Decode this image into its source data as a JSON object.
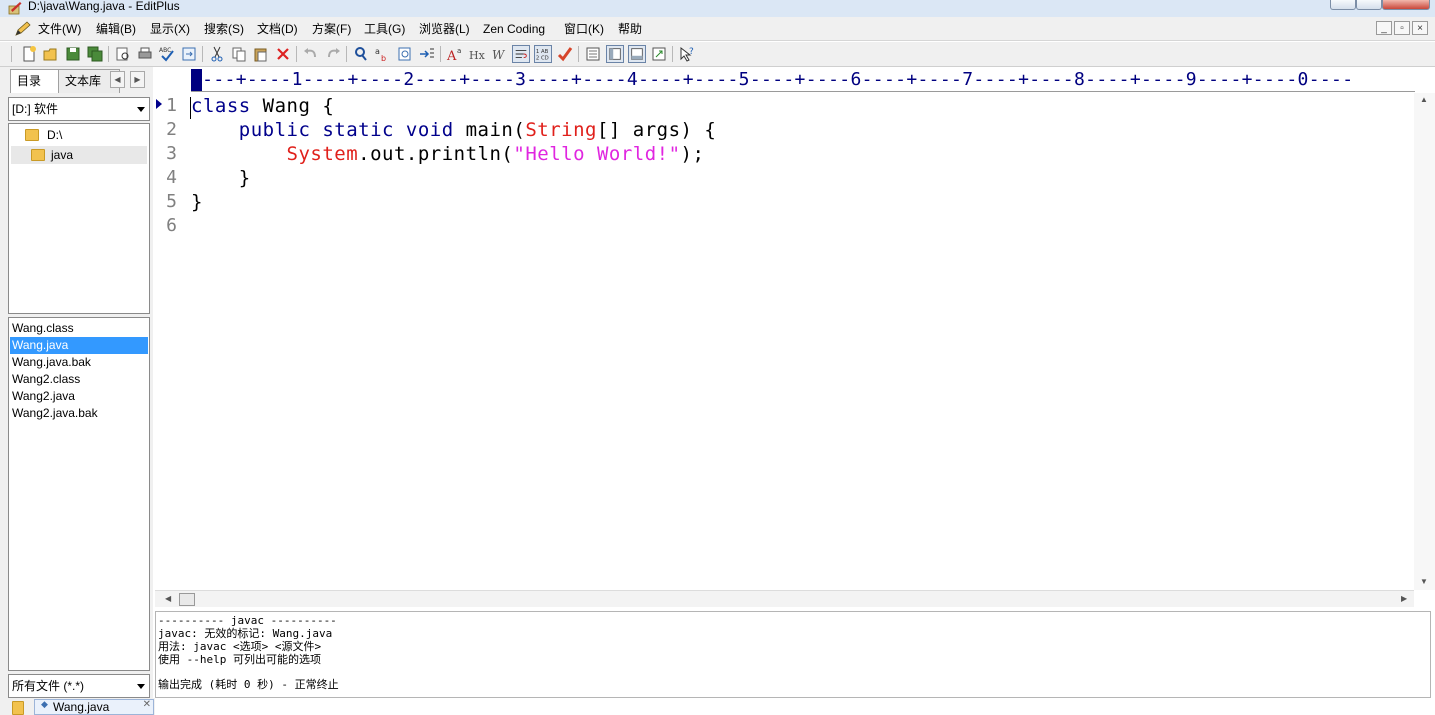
{
  "window": {
    "title": "D:\\java\\Wang.java - EditPlus"
  },
  "menu": {
    "items": [
      "文件(W)",
      "编辑(B)",
      "显示(X)",
      "搜索(S)",
      "文档(D)",
      "方案(F)",
      "工具(G)",
      "浏览器(L)",
      "Zen Coding",
      "窗口(K)",
      "帮助"
    ]
  },
  "toolbar": {
    "icons": [
      "new-file-icon",
      "open-icon",
      "save-icon",
      "save-all-icon",
      "print-preview-icon",
      "print-icon",
      "spellcheck-icon",
      "browser-preview-icon",
      "cut-icon",
      "copy-icon",
      "paste-icon",
      "delete-icon",
      "undo-icon",
      "redo-icon",
      "find-icon",
      "replace-icon",
      "find-in-files-icon",
      "goto-line-icon",
      "font-icon",
      "hx-icon",
      "word-wrap-icon",
      "line-number-icon",
      "column-select-icon",
      "check-icon",
      "document-selector-icon",
      "directory-window-icon",
      "output-window-icon",
      "fullscreen-icon",
      "help-icon"
    ]
  },
  "leftpanel": {
    "tabs": [
      "目录",
      "文本库"
    ],
    "drive": "[D:] 软件",
    "directories": [
      "D:\\",
      "java"
    ],
    "files": [
      "Wang.class",
      "Wang.java",
      "Wang.java.bak",
      "Wang2.class",
      "Wang2.java",
      "Wang2.java.bak"
    ],
    "selected_file": "Wang.java",
    "filter": "所有文件 (*.*)"
  },
  "editor": {
    "ruler": "----+----1----+----2----+----3----+----4----+----5----+----6----+----7----+----8----+----9----+----0----",
    "line_numbers": [
      "1",
      "2",
      "3",
      "4",
      "5",
      "6"
    ],
    "code": {
      "l1_kw": "class",
      "l1_rest": " Wang {",
      "l2_indent": "    ",
      "l2_kw": "public static void",
      "l2_mid": " main(",
      "l2_type": "String",
      "l2_rest": "[] args) {",
      "l3_indent": "        ",
      "l3_type": "System",
      "l3_mid": ".out.println(",
      "l3_str": "\"Hello World!\"",
      "l3_rest": ");",
      "l4": "    }",
      "l5": "}"
    }
  },
  "output": {
    "lines": [
      "---------- javac ----------",
      "javac: 无效的标记: Wang.java",
      "用法: javac <选项> <源文件>",
      "使用 --help 可列出可能的选项",
      "",
      "输出完成 (耗时 0 秒) - 正常终止"
    ]
  },
  "bottom_tab": {
    "label": "Wang.java"
  },
  "colors": {
    "keyword": "#00008b",
    "type": "#e0201b",
    "string": "#e026e0",
    "line_number": "#808080",
    "ruler": "#000080",
    "selection": "#3399ff"
  }
}
